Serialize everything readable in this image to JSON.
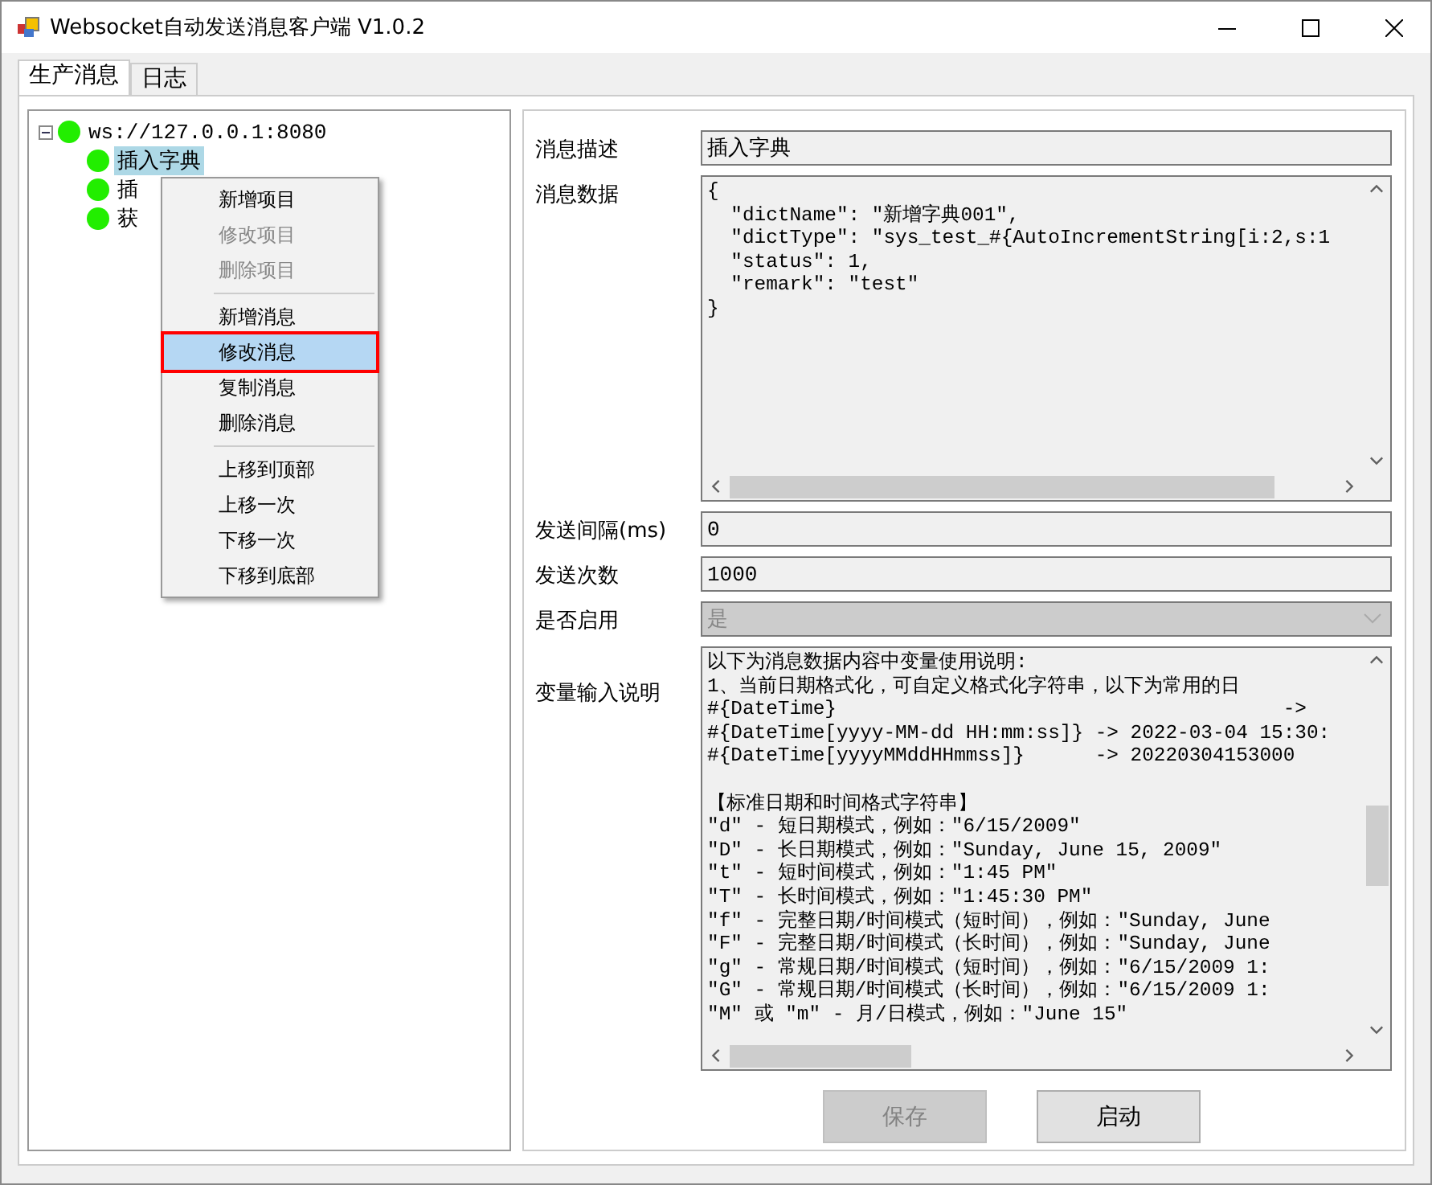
{
  "window": {
    "title": "Websocket自动发送消息客户端 V1.0.2"
  },
  "tabs": [
    {
      "label": "生产消息",
      "selected": true
    },
    {
      "label": "日志",
      "selected": false
    }
  ],
  "tree": {
    "label": "ws://127.0.0.1:8080",
    "expanded": true,
    "children": [
      {
        "label": "插入字典",
        "selected": true
      },
      {
        "label": "插",
        "selected": false
      },
      {
        "label": "获",
        "selected": false
      }
    ]
  },
  "context_menu": [
    {
      "kind": "item",
      "label": "新增项目",
      "disabled": false,
      "selected": false
    },
    {
      "kind": "item",
      "label": "修改项目",
      "disabled": true,
      "selected": false
    },
    {
      "kind": "item",
      "label": "删除项目",
      "disabled": true,
      "selected": false
    },
    {
      "kind": "separator"
    },
    {
      "kind": "item",
      "label": "新增消息",
      "disabled": false,
      "selected": false
    },
    {
      "kind": "item",
      "label": "修改消息",
      "disabled": false,
      "selected": true,
      "annotated": true
    },
    {
      "kind": "item",
      "label": "复制消息",
      "disabled": false,
      "selected": false
    },
    {
      "kind": "item",
      "label": "删除消息",
      "disabled": false,
      "selected": false
    },
    {
      "kind": "separator"
    },
    {
      "kind": "item",
      "label": "上移到顶部",
      "disabled": false,
      "selected": false
    },
    {
      "kind": "item",
      "label": "上移一次",
      "disabled": false,
      "selected": false
    },
    {
      "kind": "item",
      "label": "下移一次",
      "disabled": false,
      "selected": false
    },
    {
      "kind": "item",
      "label": "下移到底部",
      "disabled": false,
      "selected": false
    }
  ],
  "form": [
    {
      "kind": "text",
      "label": "消息描述",
      "value": "插入字典"
    },
    {
      "kind": "multiline",
      "label": "消息数据",
      "lines": [
        "{",
        "  \"dictName\": \"新增字典001\",",
        "  \"dictType\": \"sys_test_#{AutoIncrementString[i:2,s:1",
        "  \"status\": 1,",
        "  \"remark\": \"test\"",
        "}"
      ]
    },
    {
      "kind": "text",
      "label": "发送间隔(ms)",
      "value": "0"
    },
    {
      "kind": "text",
      "label": "发送次数",
      "value": "1000"
    },
    {
      "kind": "select",
      "label": "是否启用",
      "value": "是",
      "disabled": true
    },
    {
      "kind": "multiline",
      "label": "变量输入说明",
      "lines": [
        "以下为消息数据内容中变量使用说明:",
        "1、当前日期格式化，可自定义格式化字符串，以下为常用的日",
        "#{DateTime}                                      ->",
        "#{DateTime[yyyy-MM-dd HH:mm:ss]} -> 2022-03-04 15:30:",
        "#{DateTime[yyyyMMddHHmmss]}      -> 20220304153000"
      ],
      "more_lines": [
        "【标准日期和时间格式字符串】",
        "\"d\" - 短日期模式，例如：\"6/15/2009\"",
        "\"D\" - 长日期模式，例如：\"Sunday, June 15, 2009\"",
        "\"t\" - 短时间模式，例如：\"1:45 PM\"",
        "\"T\" - 长时间模式，例如：\"1:45:30 PM\"",
        "\"f\" - 完整日期/时间模式（短时间），例如：\"Sunday, June",
        "\"F\" - 完整日期/时间模式（长时间），例如：\"Sunday, June",
        "\"g\" - 常规日期/时间模式（短时间），例如：\"6/15/2009 1:",
        "\"G\" - 常规日期/时间模式（长时间），例如：\"6/15/2009 1:",
        "\"M\" 或 \"m\" - 月/日模式，例如：\"June 15\""
      ]
    }
  ],
  "buttons": [
    {
      "label": "保存",
      "disabled": true
    },
    {
      "label": "启动",
      "disabled": false
    }
  ]
}
